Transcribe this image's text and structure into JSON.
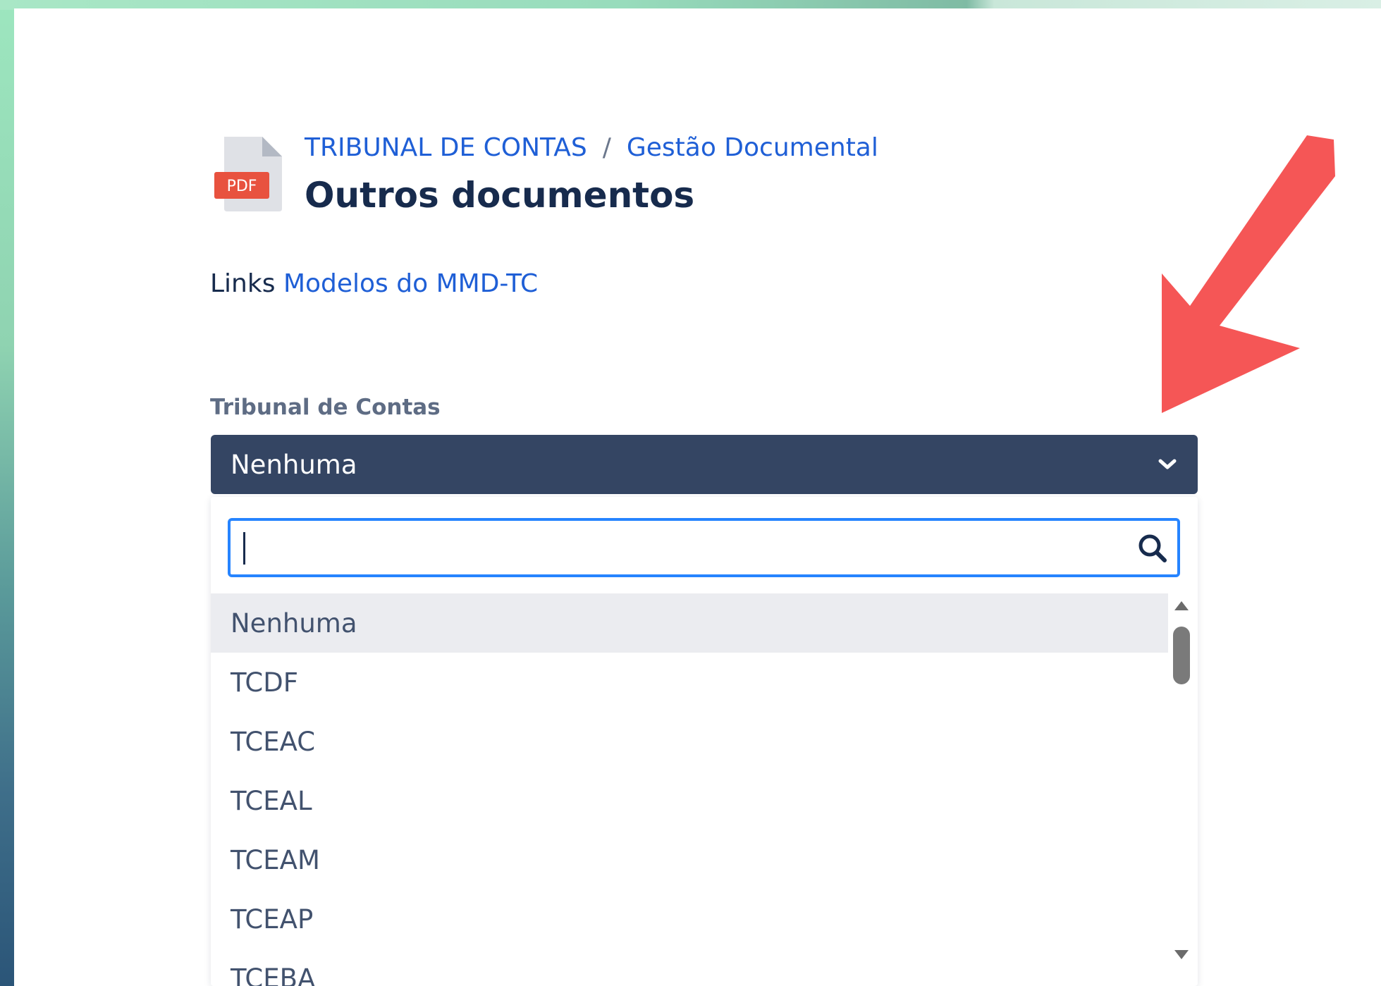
{
  "header": {
    "icon_label": "PDF",
    "breadcrumb": [
      "TRIBUNAL DE CONTAS",
      "Gestão Documental"
    ],
    "breadcrumb_separator": "/",
    "title": "Outros documentos"
  },
  "links": {
    "label": "Links",
    "link_text": "Modelos do MMD-TC"
  },
  "field": {
    "label": "Tribunal de Contas",
    "selected_value": "Nenhuma"
  },
  "dropdown": {
    "search_value": "",
    "options": [
      "Nenhuma",
      "TCDF",
      "TCEAC",
      "TCEAL",
      "TCEAM",
      "TCEAP",
      "TCEBA"
    ],
    "highlighted_option": "Nenhuma"
  },
  "icons": {
    "document": "pdf-document-icon",
    "chevron": "chevron-down-icon",
    "search": "search-icon",
    "annotation": "red-arrow-annotation"
  },
  "colors": {
    "select_background": "#344563",
    "link": "#1f5fd6",
    "focus_border": "#2684ff",
    "annotation_arrow": "#f55656",
    "pdf_badge": "#e8523f"
  }
}
